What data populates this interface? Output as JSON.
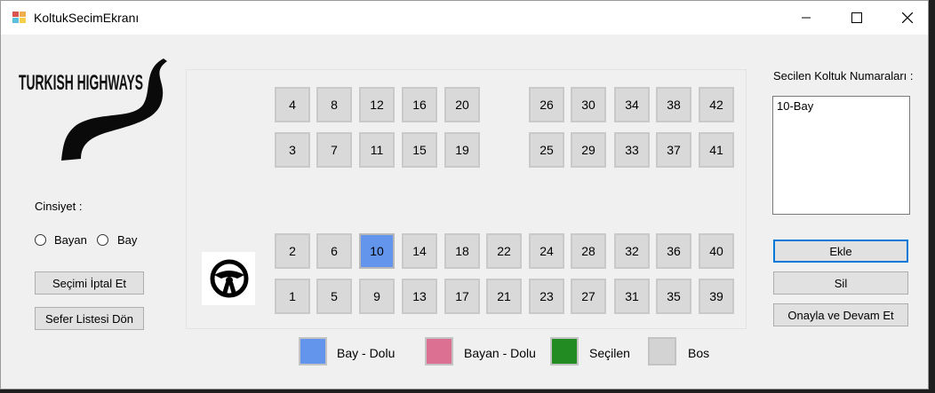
{
  "window": {
    "title": "KoltukSecimEkranı"
  },
  "logo": {
    "text": "TURKISH HIGHWAYS"
  },
  "gender": {
    "label": "Cinsiyet :",
    "options": [
      "Bayan",
      "Bay"
    ]
  },
  "buttons": {
    "cancel": "Seçimi İptal Et",
    "back": "Sefer Listesi Dön",
    "add": "Ekle",
    "delete": "Sil",
    "confirm": "Onayla ve Devam Et"
  },
  "seats": {
    "top_row1": [
      "4",
      "8",
      "12",
      "16",
      "20",
      "26",
      "30",
      "34",
      "38",
      "42"
    ],
    "top_row2": [
      "3",
      "7",
      "11",
      "15",
      "19",
      "25",
      "29",
      "33",
      "37",
      "41"
    ],
    "bottom_row1": [
      "2",
      "6",
      "10",
      "14",
      "18",
      "22",
      "24",
      "28",
      "32",
      "36",
      "40"
    ],
    "bottom_row2": [
      "1",
      "5",
      "9",
      "13",
      "17",
      "21",
      "23",
      "27",
      "31",
      "35",
      "39"
    ],
    "selected": "10"
  },
  "legend": [
    {
      "label": "Bay - Dolu",
      "color": "#6495ed"
    },
    {
      "label": "Bayan - Dolu",
      "color": "#db7093"
    },
    {
      "label": "Seçilen",
      "color": "#228b22"
    },
    {
      "label": "Bos",
      "color": "#d3d3d3"
    }
  ],
  "selected_list": {
    "label": "Secilen Koltuk Numaraları :",
    "items": [
      "10-Bay"
    ]
  }
}
